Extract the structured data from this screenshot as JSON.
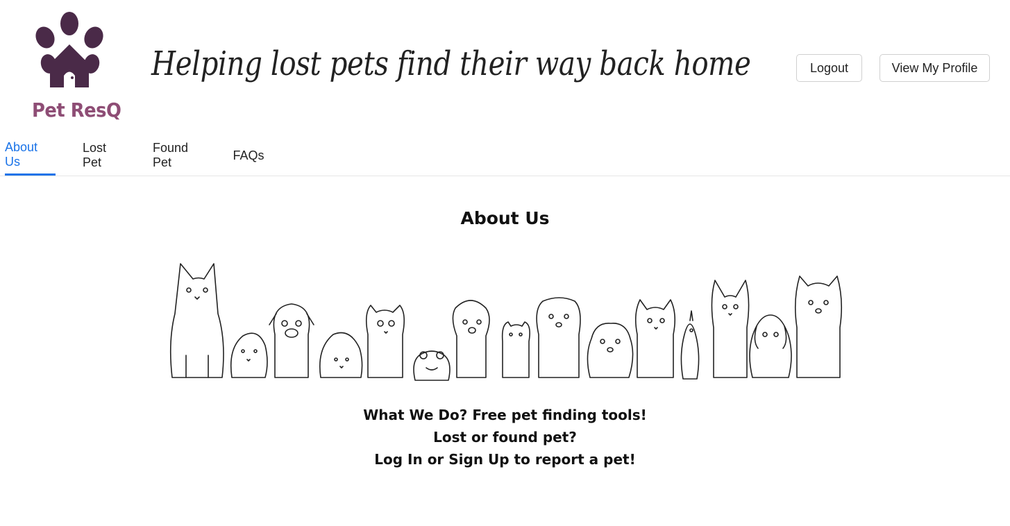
{
  "brand": {
    "logo_text": "Pet ResQ",
    "logo_color": "#4a2a48",
    "logo_text_color": "#8e4d75",
    "tagline": "Helping lost pets find their way back home"
  },
  "header": {
    "logout_label": "Logout",
    "profile_label": "View My Profile"
  },
  "tabs": [
    {
      "label": "About Us",
      "active": true
    },
    {
      "label": "Lost Pet",
      "active": false
    },
    {
      "label": "Found Pet",
      "active": false
    },
    {
      "label": "FAQs",
      "active": false
    }
  ],
  "accent_color": "#1a73e8",
  "main": {
    "title": "About Us",
    "lines": [
      "What We Do? Free pet finding tools!",
      "Lost or found pet?",
      "Log In or Sign Up to report a pet!"
    ]
  }
}
